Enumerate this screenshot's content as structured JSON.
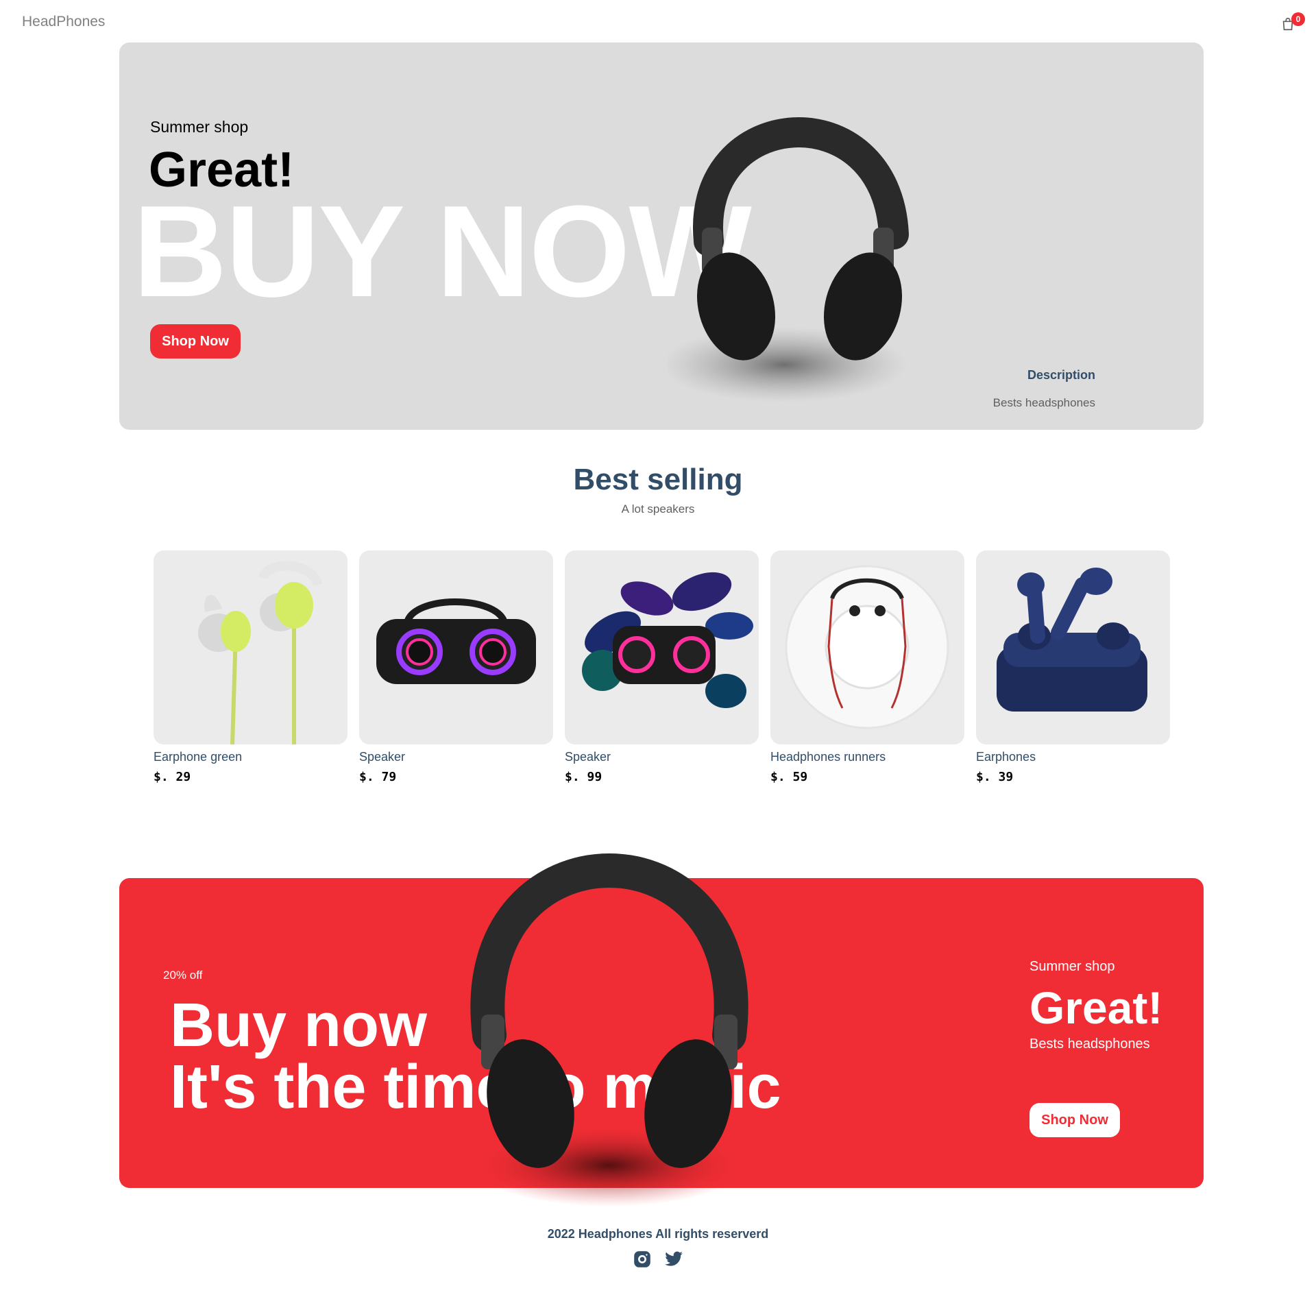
{
  "navbar": {
    "logo": "HeadPhones",
    "cart_count": "0"
  },
  "hero": {
    "small_text": "Summer shop",
    "mid_text": "Great!",
    "large_text": "BUY NOW",
    "button": "Shop Now",
    "desc_title": "Description",
    "desc_text": "Bests headsphones"
  },
  "products_heading": {
    "title": "Best selling",
    "subtitle": "A lot speakers"
  },
  "products": [
    {
      "name": "Earphone green",
      "price": "$. 29"
    },
    {
      "name": "Speaker",
      "price": "$. 79"
    },
    {
      "name": "Speaker",
      "price": "$. 99"
    },
    {
      "name": "Headphones runners",
      "price": "$. 59"
    },
    {
      "name": "Earphones",
      "price": "$. 39"
    }
  ],
  "banner": {
    "discount": "20% off",
    "title_line1": "Buy now",
    "title_line2": "It's the time to music",
    "small_text": "Summer shop",
    "mid_text": "Great!",
    "desc": "Bests headsphones",
    "button": "Shop Now"
  },
  "footer": {
    "text": "2022 Headphones All rights reserverd"
  },
  "colors": {
    "accent": "#f02d34",
    "text_dark": "#324d67",
    "hero_bg": "#dcdcdc",
    "card_bg": "#ebebeb"
  },
  "icons": [
    "shopping-bag-icon",
    "instagram-icon",
    "twitter-icon"
  ]
}
